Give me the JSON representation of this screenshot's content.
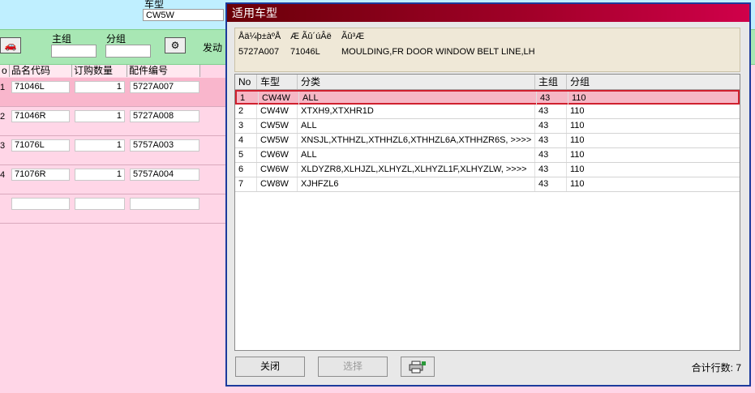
{
  "background": {
    "model_label": "车型",
    "model_value": "CW5W",
    "toolbar": {
      "main_group_label": "主组",
      "sub_group_label": "分组",
      "engine_label": "发动"
    },
    "table": {
      "columns": [
        "o",
        "品名代码",
        "订购数量",
        "配件编号"
      ],
      "rows": [
        {
          "no": "1",
          "code": "71046L",
          "qty": "1",
          "part": "5727A007"
        },
        {
          "no": "2",
          "code": "71046R",
          "qty": "1",
          "part": "5727A008"
        },
        {
          "no": "3",
          "code": "71076L",
          "qty": "1",
          "part": "5757A003"
        },
        {
          "no": "4",
          "code": "71076R",
          "qty": "1",
          "part": "5757A004"
        }
      ]
    }
  },
  "dialog": {
    "title": "适用车型",
    "info": {
      "headers": [
        "Åä¼þ±àºÅ",
        "Æ Ãû´úÂë",
        "Ãû³Æ"
      ],
      "values": [
        "5727A007",
        "71046L",
        "MOULDING,FR DOOR WINDOW BELT LINE,LH"
      ]
    },
    "grid": {
      "columns": [
        "No",
        "车型",
        "分类",
        "主组",
        "分组"
      ],
      "rows": [
        {
          "no": "1",
          "model": "CW4W",
          "category": "ALL",
          "main": "43",
          "sub": "110"
        },
        {
          "no": "2",
          "model": "CW4W",
          "category": "XTXH9,XTXHR1D",
          "main": "43",
          "sub": "110"
        },
        {
          "no": "3",
          "model": "CW5W",
          "category": "ALL",
          "main": "43",
          "sub": "110"
        },
        {
          "no": "4",
          "model": "CW5W",
          "category": "XNSJL,XTHHZL,XTHHZL6,XTHHZL6A,XTHHZR6S,  >>>>",
          "main": "43",
          "sub": "110"
        },
        {
          "no": "5",
          "model": "CW6W",
          "category": "ALL",
          "main": "43",
          "sub": "110"
        },
        {
          "no": "6",
          "model": "CW6W",
          "category": "XLDYZR8,XLHJZL,XLHYZL,XLHYZL1F,XLHYZLW,  >>>>",
          "main": "43",
          "sub": "110"
        },
        {
          "no": "7",
          "model": "CW8W",
          "category": "XJHFZL6",
          "main": "43",
          "sub": "110"
        }
      ]
    },
    "buttons": {
      "close": "关闭",
      "select": "选择",
      "print_icon": "printer-icon"
    },
    "total_label": "合计行数: 7"
  }
}
